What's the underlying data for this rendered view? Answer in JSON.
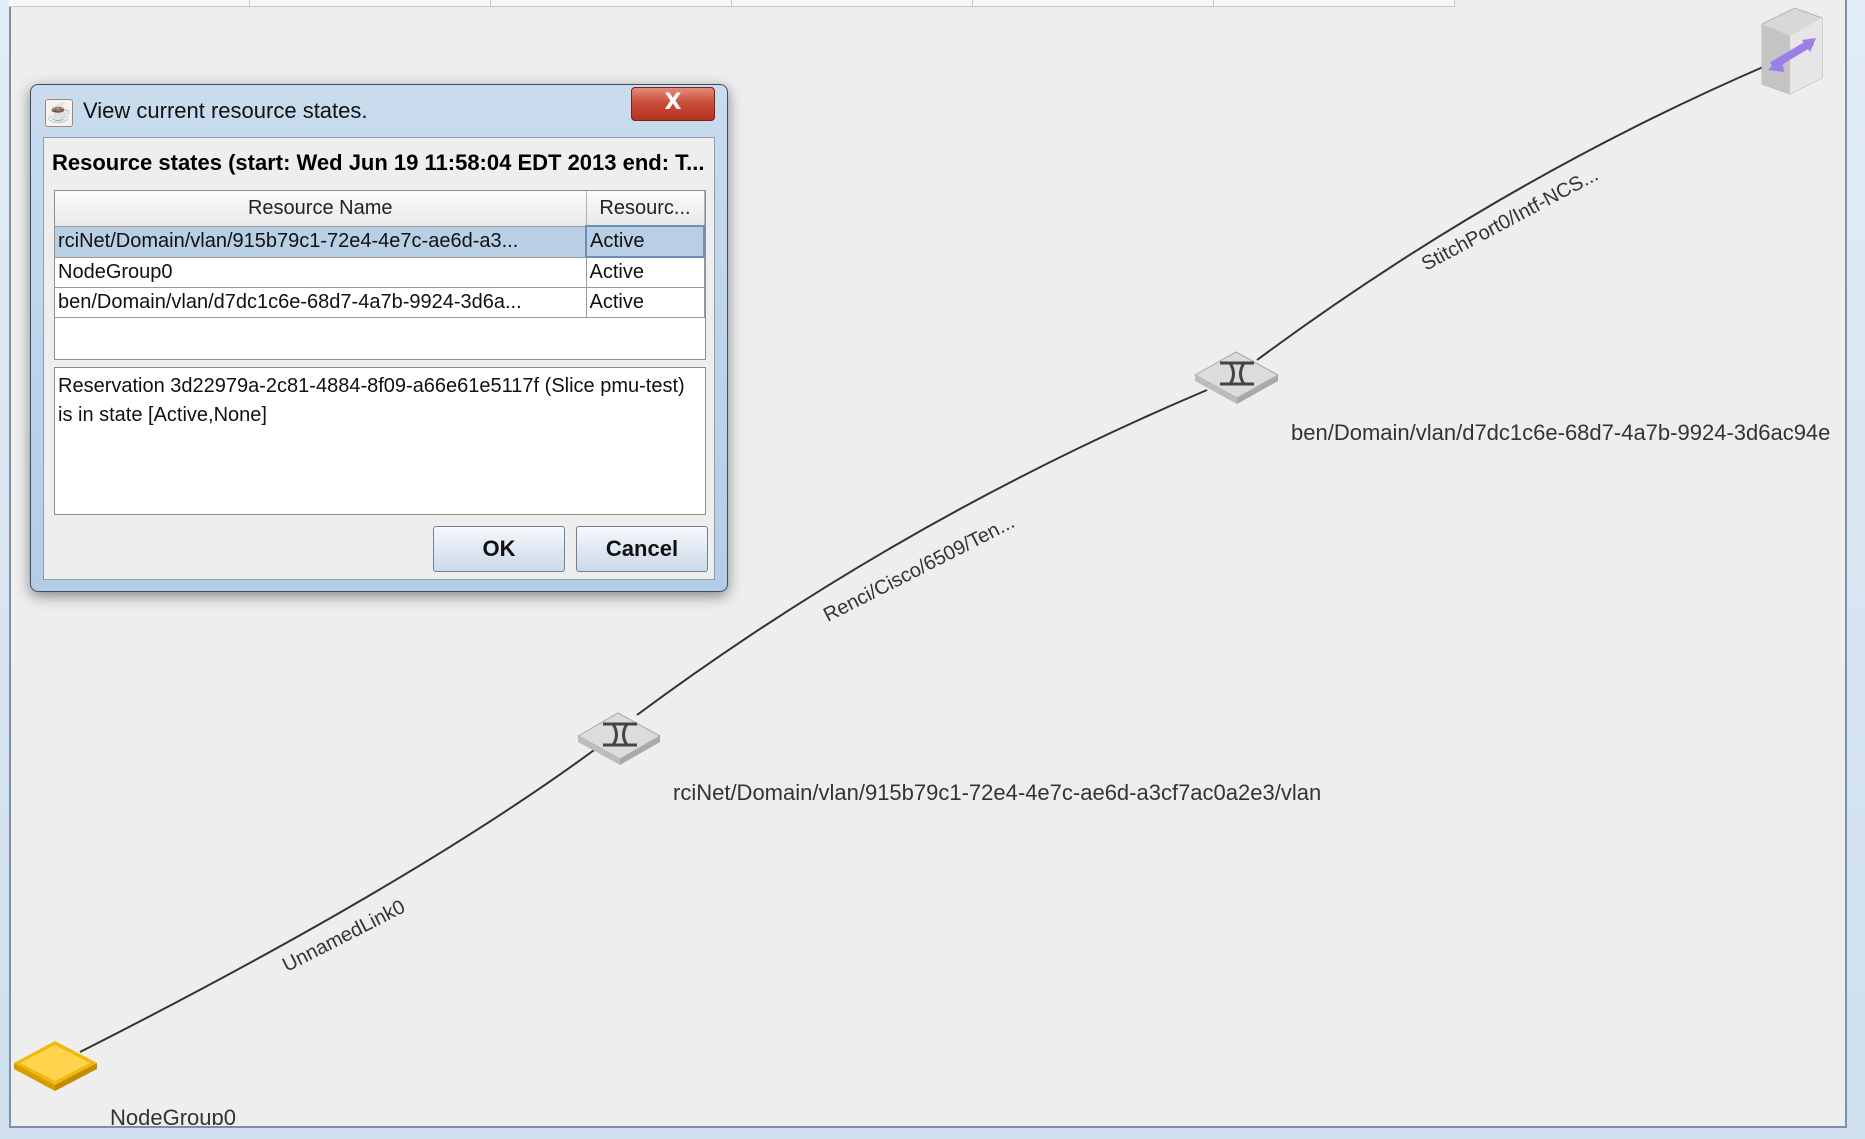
{
  "dialog": {
    "title": "View current resource states.",
    "close_label": "X",
    "heading": "Resource states (start: Wed Jun 19 11:58:04 EDT 2013 end: T...",
    "table": {
      "columns": [
        "Resource Name",
        "Resourc..."
      ],
      "rows": [
        {
          "name": "rciNet/Domain/vlan/915b79c1-72e4-4e7c-ae6d-a3...",
          "state": "Active",
          "selected": true
        },
        {
          "name": "NodeGroup0",
          "state": "Active",
          "selected": false
        },
        {
          "name": "ben/Domain/vlan/d7dc1c6e-68d7-4a7b-9924-3d6a...",
          "state": "Active",
          "selected": false
        }
      ]
    },
    "details": "Reservation 3d22979a-2c81-4884-8f09-a66e61e5117f (Slice pmu-test) is in state [Active,None]",
    "ok_label": "OK",
    "cancel_label": "Cancel"
  },
  "topology": {
    "nodes": [
      {
        "label": "NodeGroup0",
        "icon": "node-group-icon",
        "color": "#f5c518"
      },
      {
        "label": "rciNet/Domain/vlan/915b79c1-72e4-4e7c-ae6d-a3cf7ac0a2e3/vlan",
        "icon": "switch-icon"
      },
      {
        "label": "ben/Domain/vlan/d7dc1c6e-68d7-4a7b-9924-3d6ac94e",
        "icon": "switch-icon"
      },
      {
        "label": "",
        "icon": "stitchport-icon",
        "color": "#9b7fe6"
      }
    ],
    "links": [
      {
        "label": "UnnamedLink0"
      },
      {
        "label": "Renci/Cisco/6509/Ten..."
      },
      {
        "label": "StitchPort0/Intf-NCS..."
      }
    ]
  }
}
